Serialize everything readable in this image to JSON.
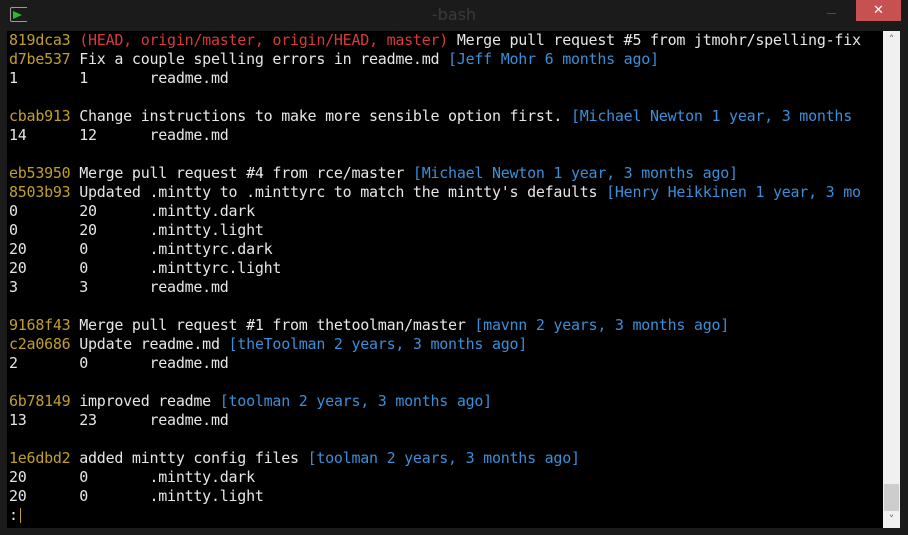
{
  "window": {
    "title": "-bash",
    "icon": "terminal-icon",
    "buttons": {
      "minimize": "minimize-icon",
      "maximize": "maximize-icon",
      "close": "✕"
    }
  },
  "colors": {
    "hash": "#c0a028",
    "refs": "#d83a3a",
    "meta": "#3a8fd8",
    "text": "#e6e6e6",
    "background": "#000000",
    "close_button": "#c75050"
  },
  "log": [
    {
      "type": "commit",
      "hash": "819dca3",
      "refs": "(HEAD, origin/master, origin/HEAD, master)",
      "message": "Merge pull request #5 from jtmohr/spelling-fix",
      "meta": ""
    },
    {
      "type": "commit",
      "hash": "d7be537",
      "refs": "",
      "message": "Fix a couple spelling errors in readme.md",
      "meta": "[Jeff Mohr 6 months ago]"
    },
    {
      "type": "stat",
      "added": "1",
      "removed": "1",
      "file": "readme.md"
    },
    {
      "type": "blank"
    },
    {
      "type": "commit",
      "hash": "cbab913",
      "refs": "",
      "message": "Change instructions to make more sensible option first.",
      "meta": "[Michael Newton 1 year, 3 months"
    },
    {
      "type": "stat",
      "added": "14",
      "removed": "12",
      "file": "readme.md"
    },
    {
      "type": "blank"
    },
    {
      "type": "commit",
      "hash": "eb53950",
      "refs": "",
      "message": "Merge pull request #4 from rce/master",
      "meta": "[Michael Newton 1 year, 3 months ago]"
    },
    {
      "type": "commit",
      "hash": "8503b93",
      "refs": "",
      "message": "Updated .mintty to .minttyrc to match the mintty's defaults",
      "meta": "[Henry Heikkinen 1 year, 3 mo"
    },
    {
      "type": "stat",
      "added": "0",
      "removed": "20",
      "file": ".mintty.dark"
    },
    {
      "type": "stat",
      "added": "0",
      "removed": "20",
      "file": ".mintty.light"
    },
    {
      "type": "stat",
      "added": "20",
      "removed": "0",
      "file": ".minttyrc.dark"
    },
    {
      "type": "stat",
      "added": "20",
      "removed": "0",
      "file": ".minttyrc.light"
    },
    {
      "type": "stat",
      "added": "3",
      "removed": "3",
      "file": "readme.md"
    },
    {
      "type": "blank"
    },
    {
      "type": "commit",
      "hash": "9168f43",
      "refs": "",
      "message": "Merge pull request #1 from thetoolman/master",
      "meta": "[mavnn 2 years, 3 months ago]"
    },
    {
      "type": "commit",
      "hash": "c2a0686",
      "refs": "",
      "message": "Update readme.md",
      "meta": "[theToolman 2 years, 3 months ago]"
    },
    {
      "type": "stat",
      "added": "2",
      "removed": "0",
      "file": "readme.md"
    },
    {
      "type": "blank"
    },
    {
      "type": "commit",
      "hash": "6b78149",
      "refs": "",
      "message": "improved readme",
      "meta": "[toolman 2 years, 3 months ago]"
    },
    {
      "type": "stat",
      "added": "13",
      "removed": "23",
      "file": "readme.md"
    },
    {
      "type": "blank"
    },
    {
      "type": "commit",
      "hash": "1e6dbd2",
      "refs": "",
      "message": "added mintty config files",
      "meta": "[toolman 2 years, 3 months ago]"
    },
    {
      "type": "stat",
      "added": "20",
      "removed": "0",
      "file": ".mintty.dark"
    },
    {
      "type": "stat",
      "added": "20",
      "removed": "0",
      "file": ".mintty.light"
    }
  ],
  "prompt": ":",
  "scrollbar": {
    "up": "˄",
    "down": "˅",
    "position": 1.0
  }
}
